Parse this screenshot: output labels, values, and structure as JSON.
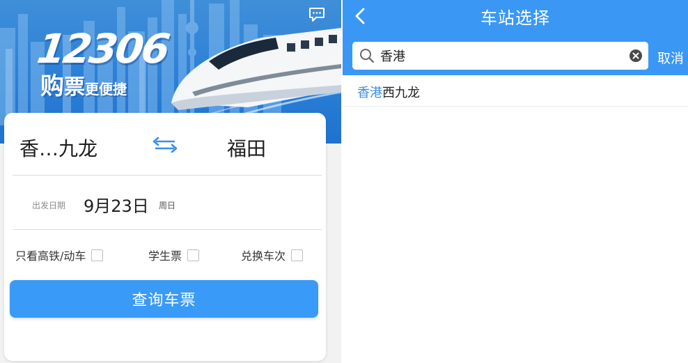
{
  "colors": {
    "accent": "#3a98f4",
    "button": "#3a9af7",
    "highlight": "#3a8ee6"
  },
  "banner": {
    "brand_number": "12306",
    "brand_slogan_big": "购",
    "brand_slogan_mid": "票",
    "brand_slogan_small": "更便捷",
    "icons": [
      "chat-bubble-icon"
    ]
  },
  "booking": {
    "from_station": "香…九龙",
    "to_station": "福田",
    "swap_icon": "swap-arrows-icon",
    "date_label": "出发日期",
    "date_value": "9月23日",
    "weekday": "周日",
    "options": [
      {
        "label": "只看高铁/动车",
        "checked": false
      },
      {
        "label": "学生票",
        "checked": false
      },
      {
        "label": "兑换车次",
        "checked": false
      }
    ],
    "query_button": "查询车票"
  },
  "station_select": {
    "title": "车站选择",
    "back_icon": "chevron-left-icon",
    "search_value": "香港",
    "cancel": "取消",
    "results": [
      {
        "match": "香港",
        "rest": "西九龙"
      }
    ]
  }
}
